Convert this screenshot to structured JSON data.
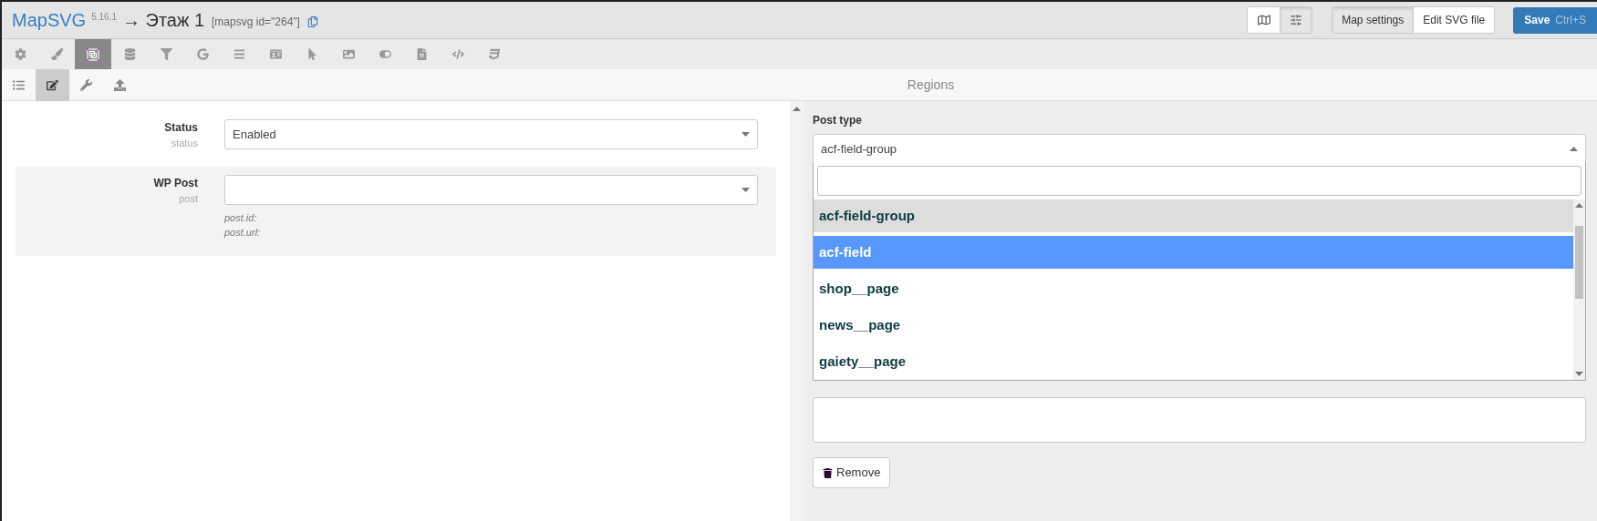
{
  "header": {
    "brand": "MapSVG",
    "version": "5.16.1",
    "title": "→ Этаж 1",
    "shortcode": "[mapsvg id=\"264\"]"
  },
  "view_toggle": [
    {
      "kind": "map",
      "selected": false
    },
    {
      "kind": "sliders",
      "selected": true
    }
  ],
  "mode_tabs": [
    {
      "label": "Map settings",
      "selected": true
    },
    {
      "label": "Edit SVG file",
      "selected": false
    }
  ],
  "save": {
    "label": "Save",
    "shortcut": "Ctrl+S"
  },
  "toolbar": [
    {
      "kind": "gear",
      "selected": false
    },
    {
      "kind": "brush",
      "selected": false
    },
    {
      "kind": "region",
      "selected": true
    },
    {
      "kind": "database",
      "selected": false
    },
    {
      "kind": "filter",
      "selected": false
    },
    {
      "kind": "g",
      "selected": false
    },
    {
      "kind": "bars",
      "selected": false
    },
    {
      "kind": "card",
      "selected": false
    },
    {
      "kind": "pointer",
      "selected": false
    },
    {
      "kind": "image",
      "selected": false
    },
    {
      "kind": "toggle",
      "selected": false
    },
    {
      "kind": "file",
      "selected": false
    },
    {
      "kind": "code",
      "selected": false
    },
    {
      "kind": "css",
      "selected": false
    }
  ],
  "subtoolbar": [
    {
      "kind": "list",
      "selected": false
    },
    {
      "kind": "edit",
      "selected": true
    },
    {
      "kind": "wrench",
      "selected": false
    },
    {
      "kind": "upload",
      "selected": false
    }
  ],
  "panel_title": "Regions",
  "status": {
    "label": "Status",
    "key": "status",
    "value": "Enabled"
  },
  "wp_post": {
    "label": "WP Post",
    "key": "post",
    "hints": [
      "post.id:",
      "post.url:"
    ]
  },
  "post_type": {
    "label": "Post type",
    "value": "acf-field-group",
    "expanded": true,
    "options": [
      {
        "label": "acf-field-group",
        "selected": true,
        "highlighted": false
      },
      {
        "label": "acf-field",
        "selected": false,
        "highlighted": true
      },
      {
        "label": "shop__page",
        "selected": false,
        "highlighted": false
      },
      {
        "label": "news__page",
        "selected": false,
        "highlighted": false
      },
      {
        "label": "gaiety__page",
        "selected": false,
        "highlighted": false
      }
    ]
  },
  "remove": {
    "label": "Remove"
  }
}
